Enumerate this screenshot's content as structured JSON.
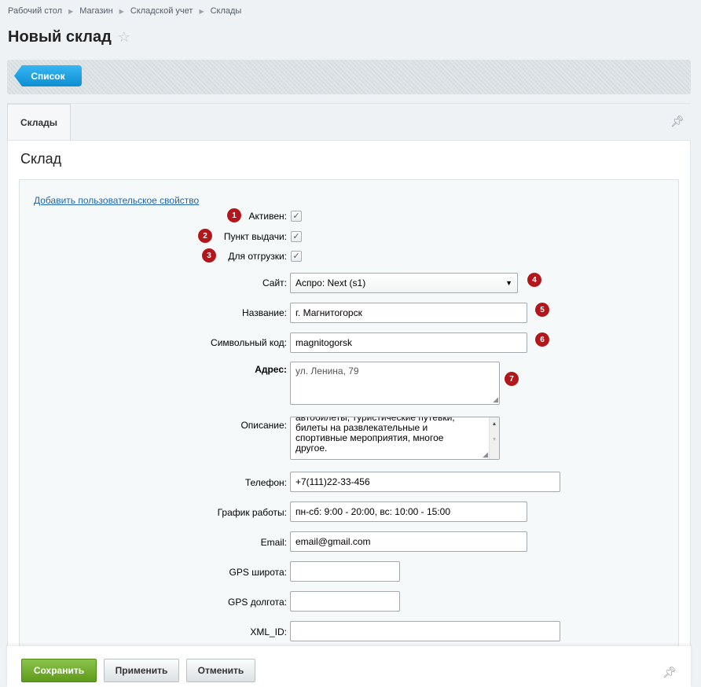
{
  "breadcrumb": [
    "Рабочий стол",
    "Магазин",
    "Складской учет",
    "Склады"
  ],
  "page": {
    "title": "Новый склад"
  },
  "toolbar": {
    "list_label": "Список"
  },
  "tabs": [
    {
      "label": "Склады"
    }
  ],
  "panel": {
    "title": "Склад",
    "add_property_link": "Добавить пользовательское свойство"
  },
  "form": {
    "active": {
      "label": "Активен:",
      "checked": true,
      "badge": "1"
    },
    "pickup": {
      "label": "Пункт выдачи:",
      "checked": true,
      "badge": "2"
    },
    "shipping": {
      "label": "Для отгрузки:",
      "checked": true,
      "badge": "3"
    },
    "site": {
      "label": "Сайт:",
      "value": "Аспро: Next (s1)",
      "badge": "4"
    },
    "name": {
      "label": "Название:",
      "value": "г. Магнитогорск",
      "badge": "5"
    },
    "code": {
      "label": "Символьный код:",
      "value": "magnitogorsk",
      "badge": "6"
    },
    "address": {
      "label": "Адрес:",
      "value": "ул. Ленина, 79",
      "badge": "7"
    },
    "description": {
      "label": "Описание:",
      "value_lines": [
        "автобилеты, туристические путевки,",
        "билеты на развлекательные и",
        "спортивные мероприятия, многое",
        "другое."
      ]
    },
    "phone": {
      "label": "Телефон:",
      "value": "+7(111)22-33-456"
    },
    "schedule": {
      "label": "График работы:",
      "value": "пн-сб: 9:00 - 20:00, вс: 10:00 - 15:00"
    },
    "email": {
      "label": "Email:",
      "value": "email@gmail.com"
    },
    "gps_lat": {
      "label": "GPS широта:",
      "value": ""
    },
    "gps_lon": {
      "label": "GPS долгота:",
      "value": ""
    },
    "xml_id": {
      "label": "XML_ID:",
      "value": ""
    }
  },
  "footer": {
    "save_label": "Сохранить",
    "apply_label": "Применить",
    "cancel_label": "Отменить"
  },
  "colors": {
    "accent_blue": "#1a9de0",
    "save_green": "#6aaa25",
    "badge_red": "#b3171b"
  },
  "icons": {
    "favorite": "star-icon",
    "pin": "pin-icon",
    "dropdown": "chevron-down-icon"
  }
}
